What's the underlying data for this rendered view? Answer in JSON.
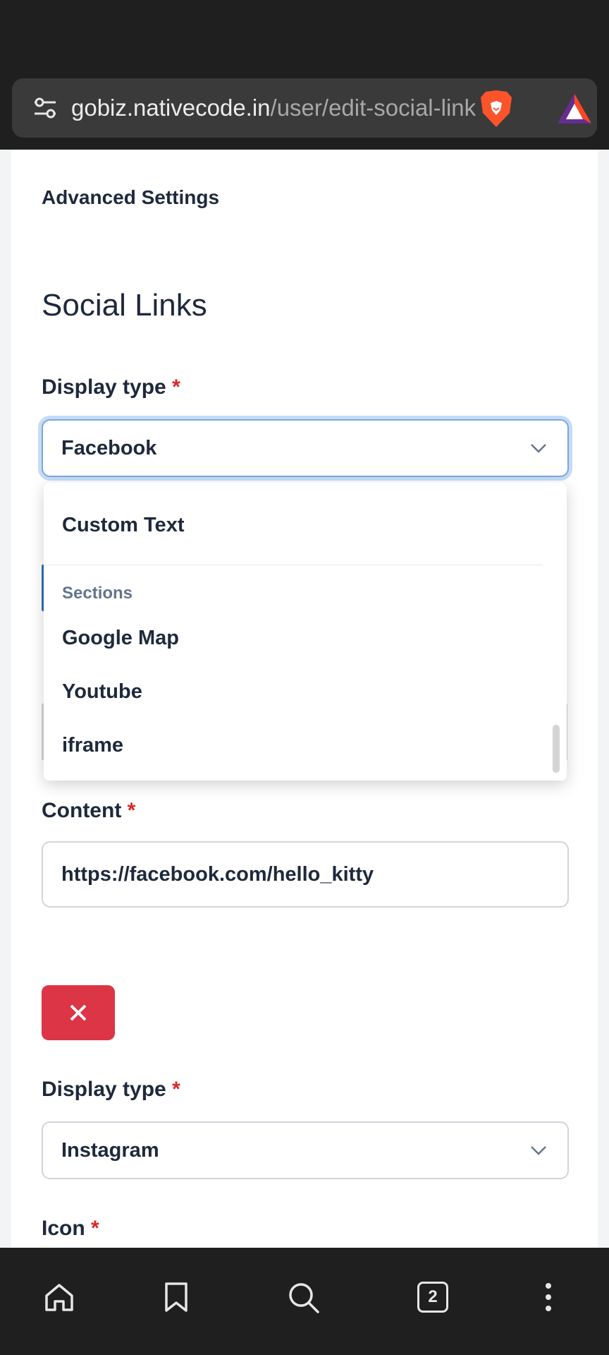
{
  "browser": {
    "url_domain": "gobiz.nativecode.in",
    "url_path": "/user/edit-social-links",
    "tab_count": "2"
  },
  "page": {
    "advanced_settings": "Advanced Settings",
    "section_title": "Social Links",
    "required_mark": "*"
  },
  "social_link_1": {
    "display_type_label": "Display type",
    "display_type_value": "Facebook",
    "content_label": "Content",
    "content_value": "https://facebook.com/hello_kitty"
  },
  "dropdown": {
    "items_top": [
      "Custom Text"
    ],
    "group_label": "Sections",
    "group_items": [
      "Google Map",
      "Youtube",
      "iframe"
    ]
  },
  "social_link_2": {
    "display_type_label": "Display type",
    "display_type_value": "Instagram",
    "icon_label": "Icon"
  },
  "colors": {
    "accent_focus": "#7aa7df",
    "danger": "#dc3545",
    "required": "#dc2626",
    "text": "#1e293b"
  },
  "icons": {
    "url_bar": [
      "page-info-icon",
      "brave-shields-icon",
      "brave-rewards-icon"
    ],
    "nav": [
      "home-icon",
      "bookmark-icon",
      "search-icon",
      "tabs-icon",
      "menu-icon"
    ],
    "select": "chevron-down-icon",
    "delete": "close-icon"
  }
}
